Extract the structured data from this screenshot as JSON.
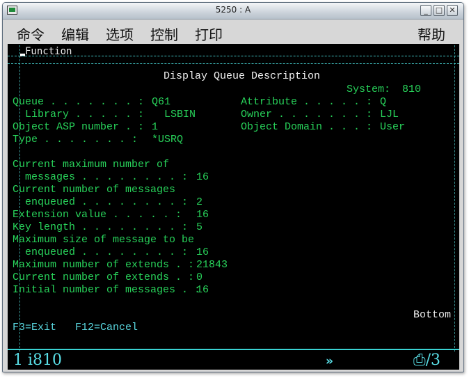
{
  "window": {
    "title": "5250 : A"
  },
  "titlebar_buttons": {
    "minimize": "_",
    "maximize": "□",
    "close": "✕"
  },
  "menu": [
    "命令",
    "编辑",
    "选项",
    "控制",
    "打印"
  ],
  "menu_help": "帮助",
  "screen": {
    "function_label": "Function",
    "heading": "Display Queue Description",
    "system_label": "System:",
    "system_value": "810",
    "fields_left": [
      {
        "label": "Queue . . . . . . . :",
        "value": "Q61"
      },
      {
        "label": "  Library . . . . . :",
        "value": "  LSBIN"
      },
      {
        "label": "Object ASP number . :",
        "value": "1"
      },
      {
        "label": "Type . . . . . . . :",
        "value": "*USRQ"
      }
    ],
    "fields_right": [
      {
        "label": "Attribute . . . . . :",
        "value": "Q"
      },
      {
        "label": "Owner . . . . . . . :",
        "value": "LJL"
      },
      {
        "label": "Object Domain . . . :",
        "value": "User"
      }
    ],
    "detail_rows": [
      {
        "label": "Current maximum number of",
        "value": ""
      },
      {
        "label": "  messages . . . . . . . . :",
        "value": "16"
      },
      {
        "label": "Current number of messages",
        "value": ""
      },
      {
        "label": "  enqueued . . . . . . . . :",
        "value": "2"
      },
      {
        "label": "Extension value . . . . . :",
        "value": "16"
      },
      {
        "label": "Key length . . . . . . . . :",
        "value": "5"
      },
      {
        "label": "Maximum size of message to be",
        "value": ""
      },
      {
        "label": "  enqueued . . . . . . . . :",
        "value": "16"
      },
      {
        "label": "Maximum number of extends . :",
        "value": "21843"
      },
      {
        "label": "Current number of extends . :",
        "value": "0"
      },
      {
        "label": "Initial number of messages . :",
        "value": "16"
      }
    ],
    "bottom_label": "Bottom",
    "fkeys": "F3=Exit   F12=Cancel"
  },
  "status": {
    "left": "1 i810",
    "mid": "»",
    "right": "⎙/3"
  }
}
